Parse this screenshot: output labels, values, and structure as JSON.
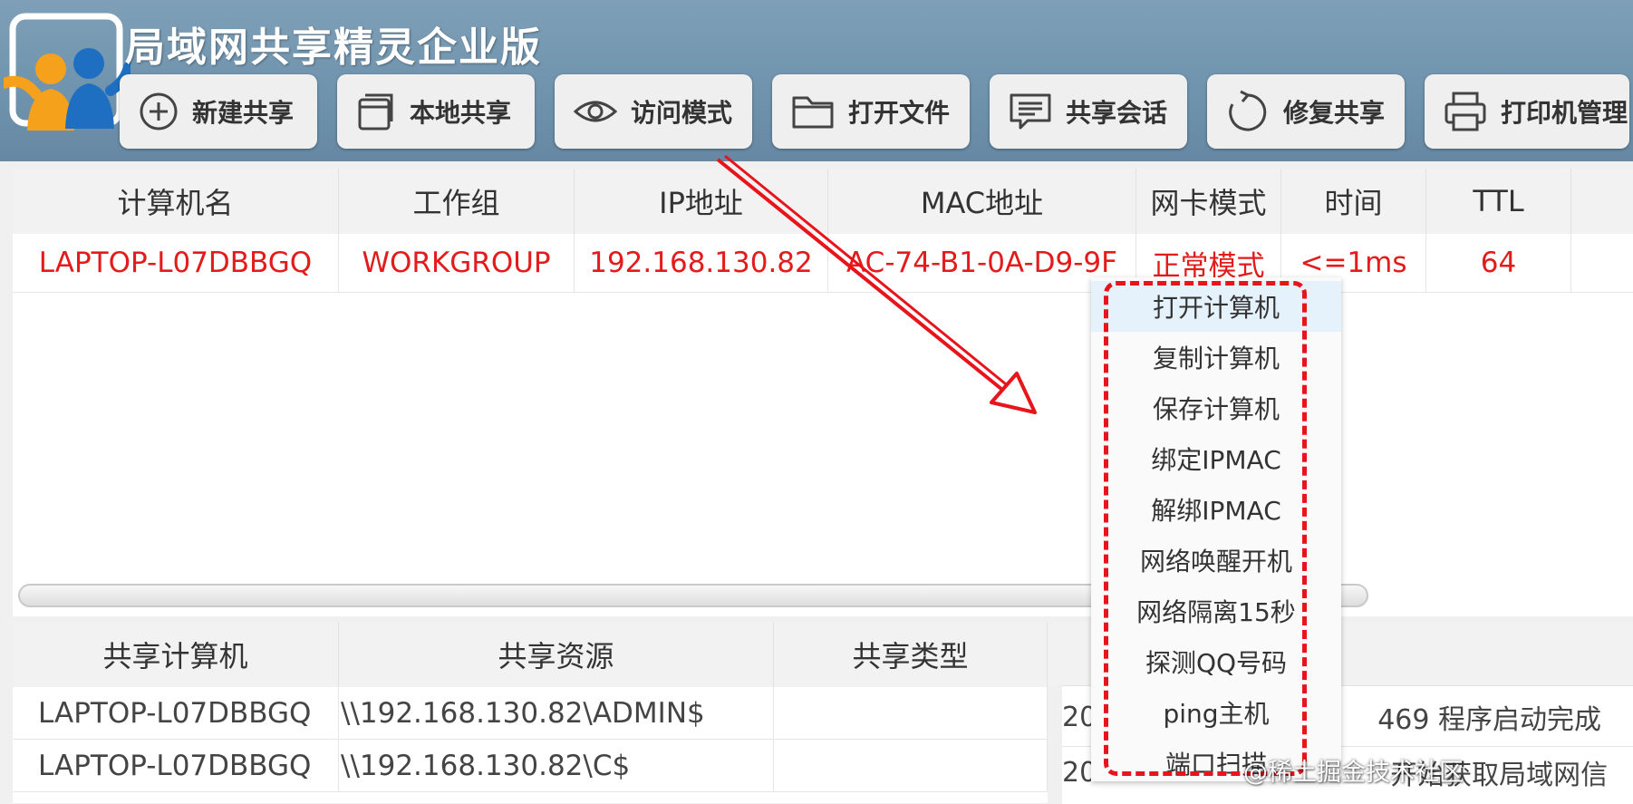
{
  "app": {
    "title": "局域网共享精灵企业版"
  },
  "toolbar": [
    {
      "label": "新建共享",
      "icon": "plus-circle-icon"
    },
    {
      "label": "本地共享",
      "icon": "window-stack-icon"
    },
    {
      "label": "访问模式",
      "icon": "eye-icon"
    },
    {
      "label": "打开文件",
      "icon": "folder-icon"
    },
    {
      "label": "共享会话",
      "icon": "chat-bubble-icon"
    },
    {
      "label": "修复共享",
      "icon": "refresh-icon"
    },
    {
      "label": "打印机管理",
      "icon": "printer-icon"
    }
  ],
  "computers": {
    "columns": [
      "计算机名",
      "工作组",
      "IP地址",
      "MAC地址",
      "网卡模式",
      "时间",
      "TTL"
    ],
    "rows": [
      {
        "name": "LAPTOP-L07DBBGQ",
        "group": "WORKGROUP",
        "ip": "192.168.130.82",
        "mac": "AC-74-B1-0A-D9-9F",
        "mode": "正常模式",
        "time": "<=1ms",
        "ttl": "64"
      }
    ]
  },
  "context_menu": {
    "items": [
      "打开计算机",
      "复制计算机",
      "保存计算机",
      "绑定IPMAC",
      "解绑IPMAC",
      "网络唤醒开机",
      "网络隔离15秒",
      "探测QQ号码",
      "ping主机",
      "端口扫描"
    ],
    "highlighted_index": 0
  },
  "shares": {
    "columns": [
      "共享计算机",
      "共享资源",
      "共享类型"
    ],
    "rows": [
      {
        "computer": "LAPTOP-L07DBBGQ",
        "resource": "\\\\192.168.130.82\\ADMIN$",
        "type": ""
      },
      {
        "computer": "LAPTOP-L07DBBGQ",
        "resource": "\\\\192.168.130.82\\C$",
        "type": ""
      }
    ]
  },
  "log": {
    "entries": [
      {
        "prefix": "20",
        "suffix": "469 程序启动完成"
      },
      {
        "prefix": "20",
        "suffix": "开始获取局域网信"
      }
    ]
  },
  "watermark": "@稀土掘金技术社区",
  "colors": {
    "accent_red": "#e31b1b",
    "header_blue": "#6f93ad",
    "annotation_red": "#e8141b"
  }
}
